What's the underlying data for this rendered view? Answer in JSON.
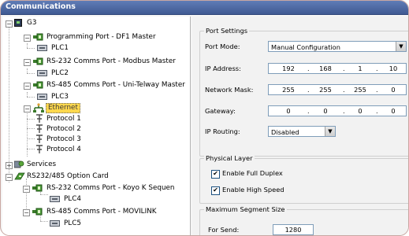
{
  "window": {
    "title": "Communications"
  },
  "tree": {
    "items": [
      {
        "label": "G3",
        "icon": "device-icon",
        "expander": "−"
      },
      {
        "label": "Programming Port - DF1 Master",
        "icon": "port-icon",
        "expander": "−"
      },
      {
        "label": "PLC1",
        "icon": "plc-icon"
      },
      {
        "label": "RS-232 Comms Port - Modbus Master",
        "icon": "port-icon",
        "expander": "−"
      },
      {
        "label": "PLC2",
        "icon": "plc-icon"
      },
      {
        "label": "RS-485 Comms Port - Uni-Telway Master",
        "icon": "port-icon",
        "expander": "−"
      },
      {
        "label": "PLC3",
        "icon": "plc-icon"
      },
      {
        "label": "Ethernet",
        "icon": "network-icon",
        "expander": "−",
        "selected": true
      },
      {
        "label": "Protocol 1",
        "icon": "protocol-icon"
      },
      {
        "label": "Protocol 2",
        "icon": "protocol-icon"
      },
      {
        "label": "Protocol 3",
        "icon": "protocol-icon"
      },
      {
        "label": "Protocol 4",
        "icon": "protocol-icon"
      },
      {
        "label": "Services",
        "icon": "services-icon",
        "expander": "+"
      },
      {
        "label": "RS232/485 Option Card",
        "icon": "option-card-icon",
        "expander": "−"
      },
      {
        "label": "RS-232 Comms Port - Koyo K Sequen",
        "icon": "port-icon",
        "expander": "−"
      },
      {
        "label": "PLC4",
        "icon": "plc-icon"
      },
      {
        "label": "RS-485 Comms Port - MOVILINK",
        "icon": "port-icon",
        "expander": "−"
      },
      {
        "label": "PLC5",
        "icon": "plc-icon"
      }
    ]
  },
  "port_settings": {
    "title": "Port Settings",
    "port_mode_label": "Port Mode:",
    "port_mode_value": "Manual Configuration",
    "ip_address_label": "IP Address:",
    "ip_address": [
      "192",
      "168",
      "1",
      "10"
    ],
    "network_mask_label": "Network Mask:",
    "network_mask": [
      "255",
      "255",
      "255",
      "0"
    ],
    "gateway_label": "Gateway:",
    "gateway": [
      "0",
      "0",
      "0",
      "0"
    ],
    "ip_routing_label": "IP Routing:",
    "ip_routing_value": "Disabled",
    "dot": "."
  },
  "physical_layer": {
    "title": "Physical Layer",
    "full_duplex_label": "Enable Full Duplex",
    "full_duplex_checked": true,
    "high_speed_label": "Enable High Speed",
    "high_speed_checked": true,
    "check_mark": "✔"
  },
  "max_segment": {
    "title": "Maximum Segment Size",
    "for_send_label": "For Send:",
    "for_send_value": "1280"
  },
  "colors": {
    "titlebar": "#4d69a5",
    "selection": "#316ac5",
    "ethernet_highlight": "#ffd84d"
  }
}
